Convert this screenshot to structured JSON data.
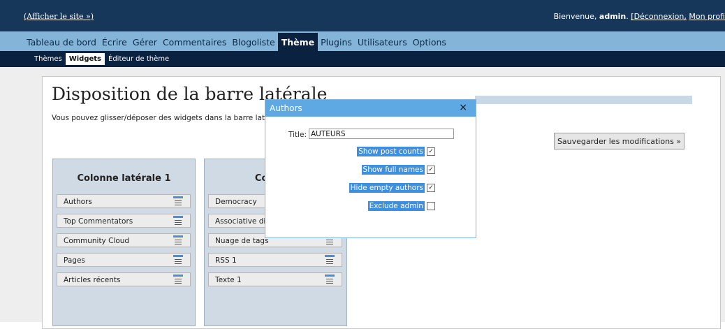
{
  "header": {
    "site_link": "(Afficher le site »)",
    "welcome_prefix": "Bienvenue,",
    "user": "admin",
    "logout": "[Déconnexion,",
    "profile": "Mon profi"
  },
  "menu": {
    "items": [
      "Tableau de bord",
      "Écrire",
      "Gérer",
      "Commentaires",
      "Blogoliste",
      "Thème",
      "Plugins",
      "Utilisateurs",
      "Options"
    ],
    "active": "Thème"
  },
  "submenu": {
    "items": [
      "Thèmes",
      "Widgets",
      "Éditeur de thème"
    ],
    "active": "Widgets"
  },
  "page": {
    "title": "Disposition de la barre latérale",
    "description": "Vous pouvez glisser/déposer des widgets dans la barre laté",
    "save_button": "Sauvegarder les modifications »"
  },
  "columns": [
    {
      "title": "Colonne latérale 1",
      "widgets": [
        "Authors",
        "Top Commentators",
        "Community Cloud",
        "Pages",
        "Articles récents"
      ]
    },
    {
      "title": "Colonne",
      "widgets": [
        "Democracy",
        "Associative dic",
        "Nuage de tags",
        "RSS 1",
        "Texte 1"
      ]
    }
  ],
  "dialog": {
    "title": "Authors",
    "close": "×",
    "title_label": "Title:",
    "title_value": "AUTEURS",
    "options": [
      {
        "label": "Show post counts",
        "checked": true
      },
      {
        "label": "Show full names",
        "checked": true
      },
      {
        "label": "Hide empty authors",
        "checked": true
      },
      {
        "label": "Exclude admin",
        "checked": false
      }
    ]
  },
  "colors": {
    "topbar": "#16365a",
    "menubar": "#85b4d9",
    "submenu": "#0b2140",
    "dialog_header": "#5ea9e4",
    "option_highlight": "#3d8fe0",
    "column_bg": "#cfdae4"
  }
}
